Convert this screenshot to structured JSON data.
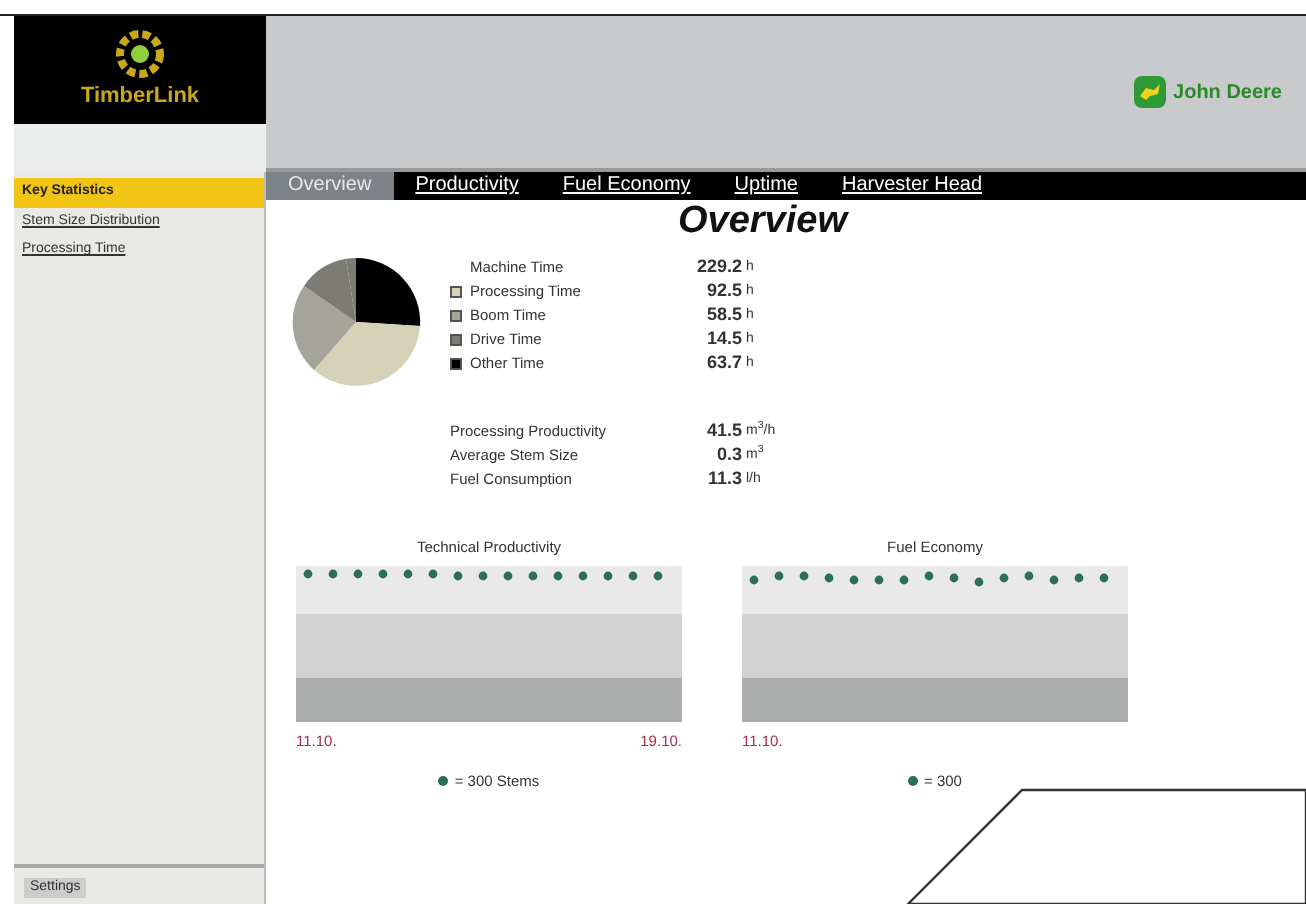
{
  "app": {
    "name": "TimberLink",
    "brand": "John Deere"
  },
  "sidebar": {
    "items": [
      {
        "label": "Key Statistics",
        "selected": true
      },
      {
        "label": "Stem Size Distribution",
        "selected": false
      },
      {
        "label": "Processing Time",
        "selected": false
      }
    ],
    "footer_button": "Settings"
  },
  "tabs": [
    {
      "label": "Overview",
      "selected": true
    },
    {
      "label": "Productivity",
      "selected": false
    },
    {
      "label": "Fuel Economy",
      "selected": false
    },
    {
      "label": "Uptime",
      "selected": false
    },
    {
      "label": "Harvester Head",
      "selected": false
    }
  ],
  "title": "Overview",
  "time_summary": {
    "label": "Machine Time",
    "value": "229.2",
    "unit": "h"
  },
  "time_breakdown": [
    {
      "label": "Processing Time",
      "value": "92.5",
      "unit": "h",
      "color": "#d6d2b8"
    },
    {
      "label": "Boom Time",
      "value": "58.5",
      "unit": "h",
      "color": "#a4a499"
    },
    {
      "label": "Drive Time",
      "value": "14.5",
      "unit": "h",
      "color": "#7c7c74"
    },
    {
      "label": "Other Time",
      "value": "63.7",
      "unit": "h",
      "color": "#000000"
    }
  ],
  "metrics": [
    {
      "label": "Processing Productivity",
      "value": "41.5",
      "unit": "m$^{3}$/h"
    },
    {
      "label": "Average Stem Size",
      "value": "0.3",
      "unit": "m$^{3}$"
    },
    {
      "label": "Fuel Consumption",
      "value": "11.3",
      "unit": "l/h"
    }
  ],
  "charts": [
    {
      "title": "Technical Productivity",
      "start": "11.10.",
      "end": "19.10.",
      "legend": "= 300 Stems"
    },
    {
      "title": "Fuel Economy",
      "start": "11.10.",
      "legend": "= 300"
    }
  ]
}
